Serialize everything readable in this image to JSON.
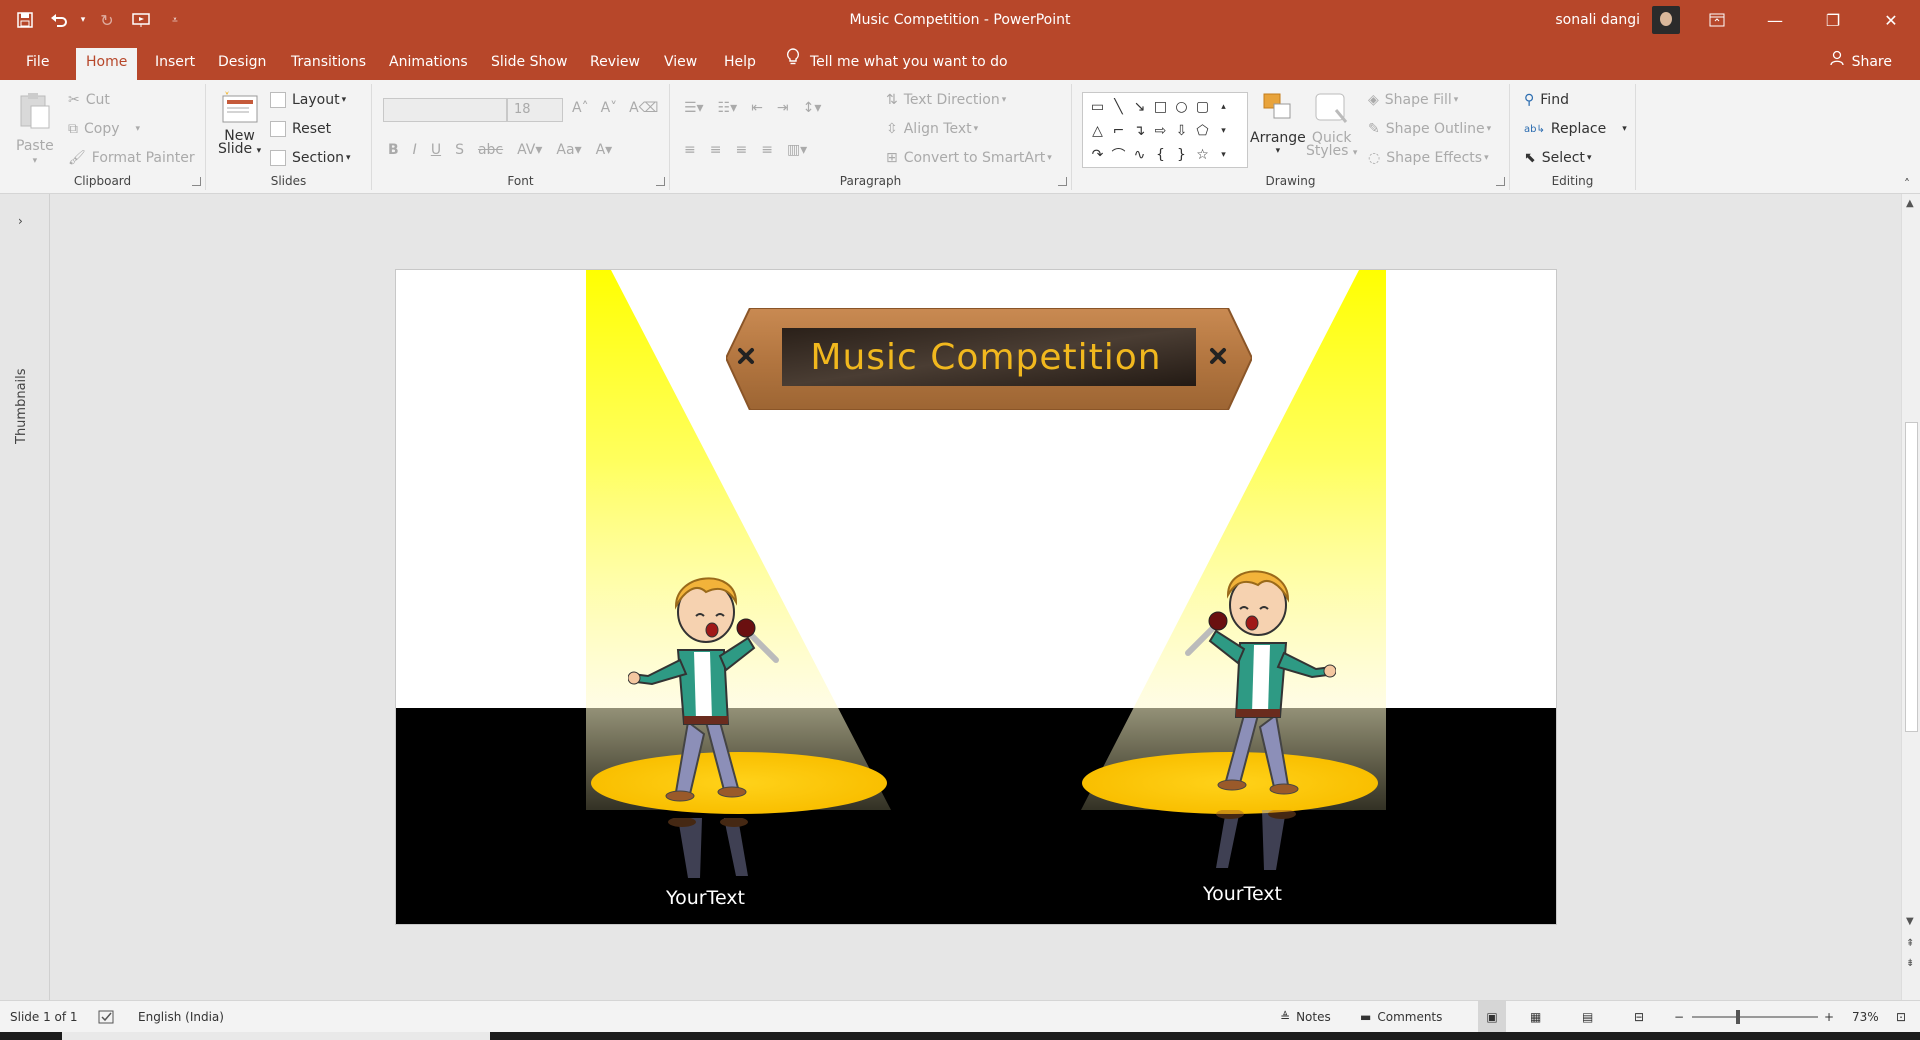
{
  "app": {
    "title": "Music Competition  -  PowerPoint",
    "user_name": "sonali dangi",
    "accent": "#b7472a"
  },
  "qat": {
    "icons": [
      "save-icon",
      "undo-icon",
      "redo-icon",
      "start-from-beginning-icon",
      "customize-qat-icon"
    ]
  },
  "tabs": {
    "file": "File",
    "home": "Home",
    "insert": "Insert",
    "design": "Design",
    "transitions": "Transitions",
    "animations": "Animations",
    "slideshow": "Slide Show",
    "review": "Review",
    "view": "View",
    "help": "Help",
    "tell_me": "Tell me what you want to do",
    "share": "Share"
  },
  "ribbon": {
    "clipboard": {
      "label": "Clipboard",
      "paste": "Paste",
      "cut": "Cut",
      "copy": "Copy",
      "format_painter": "Format Painter"
    },
    "slides": {
      "label": "Slides",
      "new_slide_line1": "New",
      "new_slide_line2": "Slide",
      "layout": "Layout",
      "reset": "Reset",
      "section": "Section"
    },
    "font": {
      "label": "Font",
      "font_name": "",
      "font_size": "18"
    },
    "paragraph": {
      "label": "Paragraph",
      "text_direction": "Text Direction",
      "align_text": "Align Text",
      "convert_smartart": "Convert to SmartArt"
    },
    "drawing": {
      "label": "Drawing",
      "arrange": "Arrange",
      "quick_styles_line1": "Quick",
      "quick_styles_line2": "Styles",
      "shape_fill": "Shape Fill",
      "shape_outline": "Shape Outline",
      "shape_effects": "Shape Effects"
    },
    "editing": {
      "label": "Editing",
      "find": "Find",
      "replace": "Replace",
      "select": "Select"
    }
  },
  "thumbnails_pane": {
    "label": "Thumbnails"
  },
  "slide": {
    "title": "Music Competition",
    "caption_left": "YourText",
    "caption_right": "YourText"
  },
  "status": {
    "slide_counter": "Slide 1 of 1",
    "language": "English (India)",
    "notes": "Notes",
    "comments": "Comments",
    "zoom": "73%"
  }
}
